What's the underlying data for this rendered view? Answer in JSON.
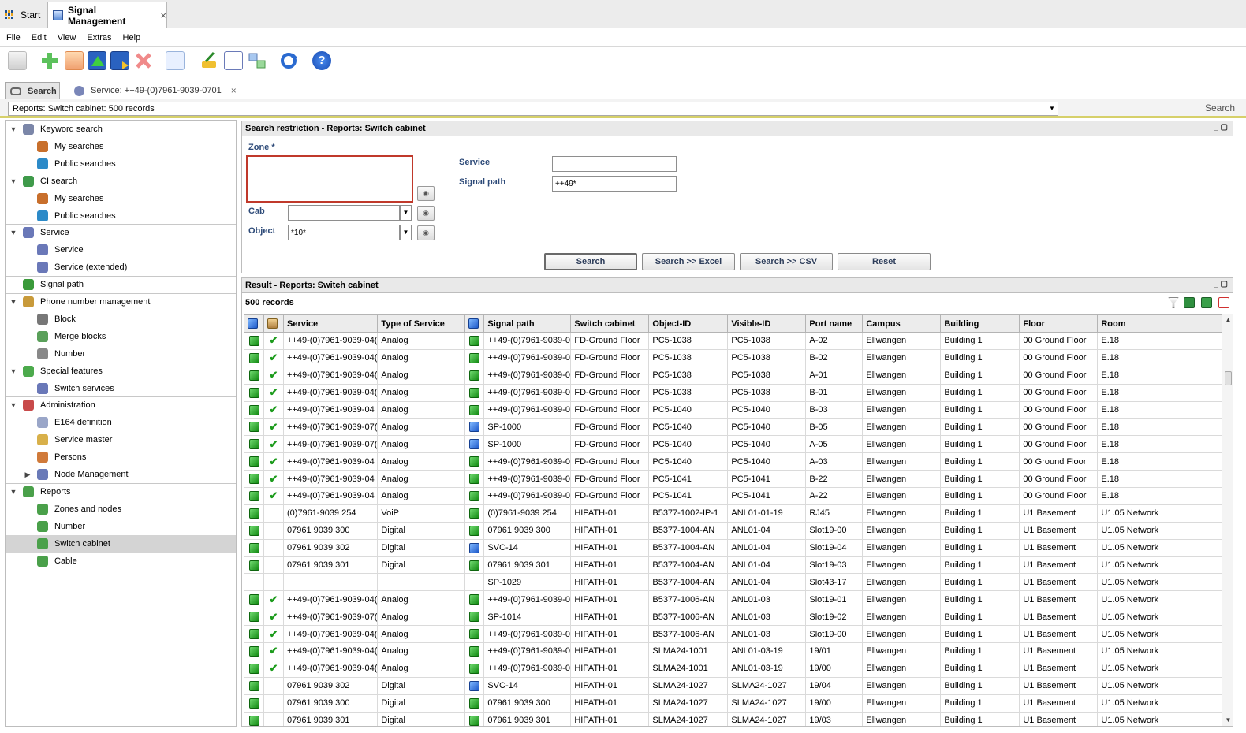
{
  "titlebar": {
    "start_label": "Start",
    "app_tab_label": "Signal Management",
    "close": "×"
  },
  "menu": [
    "File",
    "Edit",
    "View",
    "Extras",
    "Help"
  ],
  "toolbar": {
    "icons": [
      "print-icon",
      "add-icon",
      "copy-icon",
      "move-up-icon",
      "export-icon",
      "delete-icon",
      "info-icon",
      "clean-icon",
      "edit-list-icon",
      "network-icon",
      "refresh-icon",
      "help-icon"
    ],
    "help_glyph": "?"
  },
  "search_tabs": {
    "search_label": "Search",
    "service_label": "Service: ++49-(0)7961-9039-0701",
    "close": "×"
  },
  "report_selector": {
    "value": "Reports: Switch cabinet: 500 records",
    "search_label": "Search"
  },
  "tree": [
    {
      "label": "Keyword search",
      "level": 0,
      "toggle": "▼",
      "icon": "keyword-search-icon",
      "color": "#7b86a8"
    },
    {
      "label": "My searches",
      "level": 1,
      "icon": "my-searches-icon",
      "color": "#c86f2c"
    },
    {
      "label": "Public searches",
      "level": 1,
      "icon": "public-searches-icon",
      "color": "#2c8ac8"
    },
    {
      "label": "CI search",
      "level": 0,
      "toggle": "▼",
      "icon": "ci-search-icon",
      "color": "#3f9a4a"
    },
    {
      "label": "My searches",
      "level": 1,
      "icon": "my-searches-icon",
      "color": "#c86f2c"
    },
    {
      "label": "Public searches",
      "level": 1,
      "icon": "public-searches-icon",
      "color": "#2c8ac8"
    },
    {
      "label": "Service",
      "level": 0,
      "toggle": "▼",
      "icon": "service-icon",
      "color": "#6a78b8"
    },
    {
      "label": "Service",
      "level": 1,
      "icon": "service-icon",
      "color": "#6a78b8"
    },
    {
      "label": "Service (extended)",
      "level": 1,
      "icon": "service-extended-icon",
      "color": "#6a78b8"
    },
    {
      "label": "Signal path",
      "level": 0,
      "icon": "signal-path-icon",
      "color": "#3a9a3a"
    },
    {
      "label": "Phone number management",
      "level": 0,
      "toggle": "▼",
      "icon": "phone-number-icon",
      "color": "#c89a3a"
    },
    {
      "label": "Block",
      "level": 1,
      "icon": "block-icon",
      "color": "#777777"
    },
    {
      "label": "Merge blocks",
      "level": 1,
      "icon": "merge-blocks-icon",
      "color": "#5aa05a"
    },
    {
      "label": "Number",
      "level": 1,
      "icon": "number-icon",
      "color": "#888888"
    },
    {
      "label": "Special features",
      "level": 0,
      "toggle": "▼",
      "icon": "special-features-icon",
      "color": "#4caa4c"
    },
    {
      "label": "Switch services",
      "level": 1,
      "icon": "switch-services-icon",
      "color": "#6a78b8"
    },
    {
      "label": "Administration",
      "level": 0,
      "toggle": "▼",
      "icon": "administration-icon",
      "color": "#c84a4a"
    },
    {
      "label": "E164 definition",
      "level": 1,
      "icon": "document-icon",
      "color": "#9aa6c8"
    },
    {
      "label": "Service master",
      "level": 1,
      "icon": "service-master-icon",
      "color": "#d8b04a"
    },
    {
      "label": "Persons",
      "level": 1,
      "icon": "person-icon",
      "color": "#d07a3a"
    },
    {
      "label": "Node Management",
      "level": 1,
      "toggle": "▶",
      "icon": "node-management-icon",
      "color": "#6a7ab8"
    },
    {
      "label": "Reports",
      "level": 0,
      "toggle": "▼",
      "icon": "reports-icon",
      "color": "#4aa04a"
    },
    {
      "label": "Zones and nodes",
      "level": 1,
      "icon": "report-icon",
      "color": "#4aa04a"
    },
    {
      "label": "Number",
      "level": 1,
      "icon": "report-icon",
      "color": "#4aa04a"
    },
    {
      "label": "Switch cabinet",
      "level": 1,
      "icon": "report-icon",
      "color": "#4aa04a",
      "selected": true
    },
    {
      "label": "Cable",
      "level": 1,
      "icon": "report-icon",
      "color": "#4aa04a"
    }
  ],
  "restriction": {
    "title": "Search restriction - Reports: Switch cabinet",
    "zone_label": "Zone *",
    "cab_label": "Cab",
    "cab_value": "",
    "object_label": "Object",
    "object_value": "*10*",
    "service_label": "Service",
    "service_value": "",
    "signal_path_label": "Signal path",
    "signal_path_value": "++49*",
    "buttons": {
      "search": "Search",
      "search_excel": "Search >> Excel",
      "search_csv": "Search >> CSV",
      "reset": "Reset"
    },
    "window_controls": "_ ▢"
  },
  "result": {
    "title": "Result - Reports: Switch cabinet",
    "record_count": "500 records",
    "columns": [
      "",
      "",
      "Service",
      "Type of Service",
      "",
      "Signal path",
      "Switch cabinet",
      "Object-ID",
      "Visible-ID",
      "Port name",
      "Campus",
      "Building",
      "Floor",
      "Room"
    ],
    "rows": [
      {
        "s": "g",
        "c": true,
        "service": "++49-(0)7961-9039-04(",
        "type": "Analog",
        "p": "g",
        "path": "++49-(0)7961-9039-0",
        "cab": "FD-Ground Floor",
        "obj": "PC5-1038",
        "vis": "PC5-1038",
        "port": "A-02",
        "campus": "Ellwangen",
        "bld": "Building 1",
        "floor": "00 Ground Floor",
        "room": "E.18"
      },
      {
        "s": "g",
        "c": true,
        "service": "++49-(0)7961-9039-04(",
        "type": "Analog",
        "p": "g",
        "path": "++49-(0)7961-9039-0",
        "cab": "FD-Ground Floor",
        "obj": "PC5-1038",
        "vis": "PC5-1038",
        "port": "B-02",
        "campus": "Ellwangen",
        "bld": "Building 1",
        "floor": "00 Ground Floor",
        "room": "E.18"
      },
      {
        "s": "g",
        "c": true,
        "service": "++49-(0)7961-9039-04(",
        "type": "Analog",
        "p": "g",
        "path": "++49-(0)7961-9039-0",
        "cab": "FD-Ground Floor",
        "obj": "PC5-1038",
        "vis": "PC5-1038",
        "port": "A-01",
        "campus": "Ellwangen",
        "bld": "Building 1",
        "floor": "00 Ground Floor",
        "room": "E.18"
      },
      {
        "s": "g",
        "c": true,
        "service": "++49-(0)7961-9039-04(",
        "type": "Analog",
        "p": "g",
        "path": "++49-(0)7961-9039-0",
        "cab": "FD-Ground Floor",
        "obj": "PC5-1038",
        "vis": "PC5-1038",
        "port": "B-01",
        "campus": "Ellwangen",
        "bld": "Building 1",
        "floor": "00 Ground Floor",
        "room": "E.18"
      },
      {
        "s": "g",
        "c": true,
        "service": "++49-(0)7961-9039-04",
        "type": "Analog",
        "p": "g",
        "path": "++49-(0)7961-9039-0",
        "cab": "FD-Ground Floor",
        "obj": "PC5-1040",
        "vis": "PC5-1040",
        "port": "B-03",
        "campus": "Ellwangen",
        "bld": "Building 1",
        "floor": "00 Ground Floor",
        "room": "E.18"
      },
      {
        "s": "g",
        "c": true,
        "service": "++49-(0)7961-9039-07(",
        "type": "Analog",
        "p": "b",
        "path": "SP-1000",
        "cab": "FD-Ground Floor",
        "obj": "PC5-1040",
        "vis": "PC5-1040",
        "port": "B-05",
        "campus": "Ellwangen",
        "bld": "Building 1",
        "floor": "00 Ground Floor",
        "room": "E.18"
      },
      {
        "s": "g",
        "c": true,
        "service": "++49-(0)7961-9039-07(",
        "type": "Analog",
        "p": "b",
        "path": "SP-1000",
        "cab": "FD-Ground Floor",
        "obj": "PC5-1040",
        "vis": "PC5-1040",
        "port": "A-05",
        "campus": "Ellwangen",
        "bld": "Building 1",
        "floor": "00 Ground Floor",
        "room": "E.18"
      },
      {
        "s": "g",
        "c": true,
        "service": "++49-(0)7961-9039-04",
        "type": "Analog",
        "p": "g",
        "path": "++49-(0)7961-9039-0",
        "cab": "FD-Ground Floor",
        "obj": "PC5-1040",
        "vis": "PC5-1040",
        "port": "A-03",
        "campus": "Ellwangen",
        "bld": "Building 1",
        "floor": "00 Ground Floor",
        "room": "E.18"
      },
      {
        "s": "g",
        "c": true,
        "service": "++49-(0)7961-9039-04",
        "type": "Analog",
        "p": "g",
        "path": "++49-(0)7961-9039-0",
        "cab": "FD-Ground Floor",
        "obj": "PC5-1041",
        "vis": "PC5-1041",
        "port": "B-22",
        "campus": "Ellwangen",
        "bld": "Building 1",
        "floor": "00 Ground Floor",
        "room": "E.18"
      },
      {
        "s": "g",
        "c": true,
        "service": "++49-(0)7961-9039-04",
        "type": "Analog",
        "p": "g",
        "path": "++49-(0)7961-9039-0",
        "cab": "FD-Ground Floor",
        "obj": "PC5-1041",
        "vis": "PC5-1041",
        "port": "A-22",
        "campus": "Ellwangen",
        "bld": "Building 1",
        "floor": "00 Ground Floor",
        "room": "E.18"
      },
      {
        "s": "g",
        "c": false,
        "service": "(0)7961-9039 254",
        "type": "VoiP",
        "p": "g",
        "path": "(0)7961-9039 254",
        "cab": "HIPATH-01",
        "obj": "B5377-1002-IP-1",
        "vis": "ANL01-01-19",
        "port": "RJ45",
        "campus": "Ellwangen",
        "bld": "Building 1",
        "floor": "U1 Basement",
        "room": "U1.05 Network"
      },
      {
        "s": "g",
        "c": false,
        "service": "07961 9039 300",
        "type": "Digital",
        "p": "g",
        "path": "07961 9039 300",
        "cab": "HIPATH-01",
        "obj": "B5377-1004-AN",
        "vis": "ANL01-04",
        "port": "Slot19-00",
        "campus": "Ellwangen",
        "bld": "Building 1",
        "floor": "U1 Basement",
        "room": "U1.05 Network"
      },
      {
        "s": "g",
        "c": false,
        "service": "07961 9039 302",
        "type": "Digital",
        "p": "b",
        "path": "SVC-14",
        "cab": "HIPATH-01",
        "obj": "B5377-1004-AN",
        "vis": "ANL01-04",
        "port": "Slot19-04",
        "campus": "Ellwangen",
        "bld": "Building 1",
        "floor": "U1 Basement",
        "room": "U1.05 Network"
      },
      {
        "s": "g",
        "c": false,
        "service": "07961 9039 301",
        "type": "Digital",
        "p": "g",
        "path": "07961 9039 301",
        "cab": "HIPATH-01",
        "obj": "B5377-1004-AN",
        "vis": "ANL01-04",
        "port": "Slot19-03",
        "campus": "Ellwangen",
        "bld": "Building 1",
        "floor": "U1 Basement",
        "room": "U1.05 Network"
      },
      {
        "s": "",
        "c": false,
        "service": "",
        "type": "",
        "p": "",
        "path": "SP-1029",
        "cab": "HIPATH-01",
        "obj": "B5377-1004-AN",
        "vis": "ANL01-04",
        "port": "Slot43-17",
        "campus": "Ellwangen",
        "bld": "Building 1",
        "floor": "U1 Basement",
        "room": "U1.05 Network"
      },
      {
        "s": "g",
        "c": true,
        "service": "++49-(0)7961-9039-04(",
        "type": "Analog",
        "p": "g",
        "path": "++49-(0)7961-9039-0",
        "cab": "HIPATH-01",
        "obj": "B5377-1006-AN",
        "vis": "ANL01-03",
        "port": "Slot19-01",
        "campus": "Ellwangen",
        "bld": "Building 1",
        "floor": "U1 Basement",
        "room": "U1.05 Network"
      },
      {
        "s": "g",
        "c": true,
        "service": "++49-(0)7961-9039-07(",
        "type": "Analog",
        "p": "g",
        "path": "SP-1014",
        "cab": "HIPATH-01",
        "obj": "B5377-1006-AN",
        "vis": "ANL01-03",
        "port": "Slot19-02",
        "campus": "Ellwangen",
        "bld": "Building 1",
        "floor": "U1 Basement",
        "room": "U1.05 Network"
      },
      {
        "s": "g",
        "c": true,
        "service": "++49-(0)7961-9039-04(",
        "type": "Analog",
        "p": "g",
        "path": "++49-(0)7961-9039-0",
        "cab": "HIPATH-01",
        "obj": "B5377-1006-AN",
        "vis": "ANL01-03",
        "port": "Slot19-00",
        "campus": "Ellwangen",
        "bld": "Building 1",
        "floor": "U1 Basement",
        "room": "U1.05 Network"
      },
      {
        "s": "g",
        "c": true,
        "service": "++49-(0)7961-9039-04(",
        "type": "Analog",
        "p": "g",
        "path": "++49-(0)7961-9039-0",
        "cab": "HIPATH-01",
        "obj": "SLMA24-1001",
        "vis": "ANL01-03-19",
        "port": "19/01",
        "campus": "Ellwangen",
        "bld": "Building 1",
        "floor": "U1 Basement",
        "room": "U1.05 Network"
      },
      {
        "s": "g",
        "c": true,
        "service": "++49-(0)7961-9039-04(",
        "type": "Analog",
        "p": "g",
        "path": "++49-(0)7961-9039-0",
        "cab": "HIPATH-01",
        "obj": "SLMA24-1001",
        "vis": "ANL01-03-19",
        "port": "19/00",
        "campus": "Ellwangen",
        "bld": "Building 1",
        "floor": "U1 Basement",
        "room": "U1.05 Network"
      },
      {
        "s": "g",
        "c": false,
        "service": "07961 9039 302",
        "type": "Digital",
        "p": "b",
        "path": "SVC-14",
        "cab": "HIPATH-01",
        "obj": "SLMA24-1027",
        "vis": "SLMA24-1027",
        "port": "19/04",
        "campus": "Ellwangen",
        "bld": "Building 1",
        "floor": "U1 Basement",
        "room": "U1.05 Network"
      },
      {
        "s": "g",
        "c": false,
        "service": "07961 9039 300",
        "type": "Digital",
        "p": "g",
        "path": "07961 9039 300",
        "cab": "HIPATH-01",
        "obj": "SLMA24-1027",
        "vis": "SLMA24-1027",
        "port": "19/00",
        "campus": "Ellwangen",
        "bld": "Building 1",
        "floor": "U1 Basement",
        "room": "U1.05 Network"
      },
      {
        "s": "g",
        "c": false,
        "service": "07961 9039 301",
        "type": "Digital",
        "p": "g",
        "path": "07961 9039 301",
        "cab": "HIPATH-01",
        "obj": "SLMA24-1027",
        "vis": "SLMA24-1027",
        "port": "19/03",
        "campus": "Ellwangen",
        "bld": "Building 1",
        "floor": "U1 Basement",
        "room": "U1.05 Network"
      }
    ]
  },
  "colors": {
    "accent_bar": "#d6d06a",
    "zone_border": "#c0392b",
    "header_bg": "#e9e9e9"
  }
}
